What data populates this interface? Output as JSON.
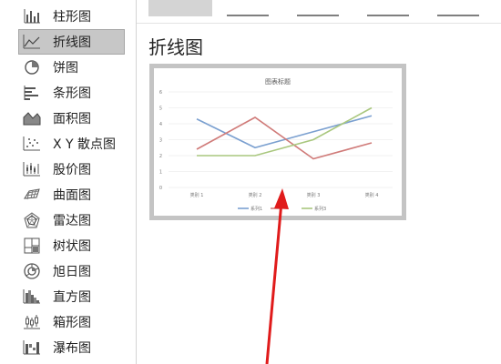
{
  "sidebar": {
    "items": [
      {
        "label": "柱形图",
        "icon": "column-chart-icon",
        "selected": false
      },
      {
        "label": "折线图",
        "icon": "line-chart-icon",
        "selected": true
      },
      {
        "label": "饼图",
        "icon": "pie-chart-icon",
        "selected": false
      },
      {
        "label": "条形图",
        "icon": "bar-chart-icon",
        "selected": false
      },
      {
        "label": "面积图",
        "icon": "area-chart-icon",
        "selected": false
      },
      {
        "label": "X Y 散点图",
        "icon": "scatter-chart-icon",
        "selected": false
      },
      {
        "label": "股价图",
        "icon": "stock-chart-icon",
        "selected": false
      },
      {
        "label": "曲面图",
        "icon": "surface-chart-icon",
        "selected": false
      },
      {
        "label": "雷达图",
        "icon": "radar-chart-icon",
        "selected": false
      },
      {
        "label": "树状图",
        "icon": "treemap-chart-icon",
        "selected": false
      },
      {
        "label": "旭日图",
        "icon": "sunburst-chart-icon",
        "selected": false
      },
      {
        "label": "直方图",
        "icon": "histogram-chart-icon",
        "selected": false
      },
      {
        "label": "箱形图",
        "icon": "box-whisker-chart-icon",
        "selected": false
      },
      {
        "label": "瀑布图",
        "icon": "waterfall-chart-icon",
        "selected": false
      }
    ]
  },
  "main": {
    "section_title": "折线图"
  },
  "chart_data": {
    "type": "line",
    "title": "图表标题",
    "categories": [
      "类别 1",
      "类别 2",
      "类别 3",
      "类别 4"
    ],
    "ylim": [
      0,
      6
    ],
    "yticks": [
      "0",
      "1",
      "2",
      "3",
      "4",
      "5",
      "6"
    ],
    "grid": true,
    "legend_position": "bottom",
    "series": [
      {
        "name": "系列1",
        "values": [
          4.3,
          2.5,
          3.5,
          4.5
        ],
        "color": "#7ba0d0"
      },
      {
        "name": "",
        "values": [
          2.4,
          4.4,
          1.8,
          2.8
        ],
        "color": "#d07b79"
      },
      {
        "name": "系列3",
        "values": [
          2.0,
          2.0,
          3.0,
          5.0
        ],
        "color": "#a9c77e"
      }
    ]
  },
  "annotation": {
    "arrow_color": "#e01b1b"
  }
}
